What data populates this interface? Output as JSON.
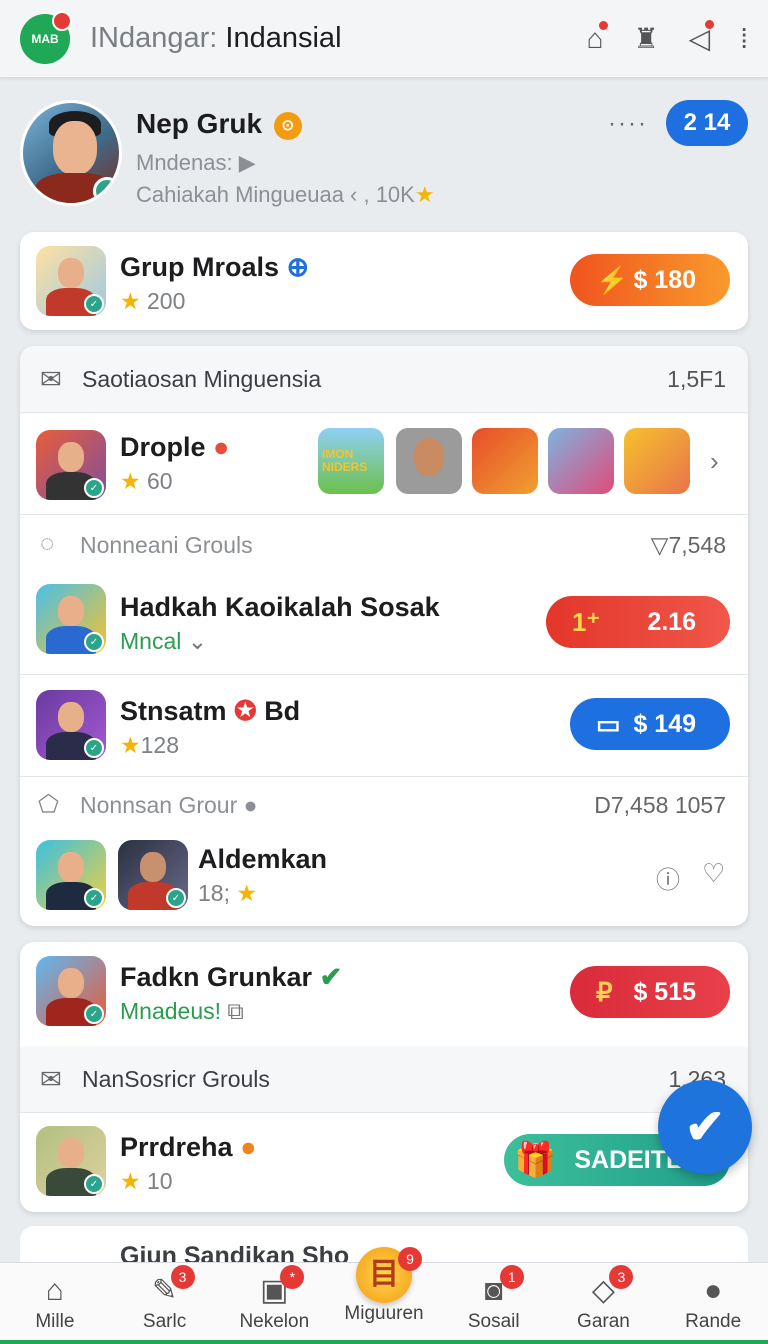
{
  "app": {
    "logo_text": "MAB",
    "title_light": "INdangar:",
    "title_bold": "Indansial",
    "icons": [
      "home-icon",
      "tools-icon",
      "share-icon",
      "more-vertical-icon"
    ]
  },
  "profile": {
    "name": "Nep Gruk",
    "subtitle": "Mndenas:",
    "stats": "Cahiakah Mingueuaa ‹ , 10K",
    "more": "····",
    "badge": "2 14"
  },
  "card1": {
    "title": "Grup Mroals",
    "rating": "200",
    "button": "$ 180"
  },
  "card2": {
    "section": {
      "label": "Saotiaosan Minguensia",
      "value": "1,5F1"
    },
    "drople": {
      "title": "Drople",
      "rating": "60"
    },
    "games": [
      "IMON NIDERS",
      "",
      "",
      "",
      ""
    ],
    "subhead1": {
      "label": "Nonneani Grouls",
      "value": "7,548"
    },
    "hadkah": {
      "title": "Hadkah Kaoikalah Sosak",
      "sub": "Mncal",
      "button": "2.16"
    },
    "stnsatm": {
      "title": "Stnsatm",
      "title_suffix": "Bd",
      "rating": "128",
      "button": "$ 149"
    },
    "subhead2": {
      "label": "Nonnsan Grour",
      "value": "D7,458 1057"
    },
    "aldemkan": {
      "title": "Aldemkan",
      "rating": "18;"
    }
  },
  "card3": {
    "fadkn": {
      "title": "Fadkn Grunkar",
      "sub": "Mnadeus!",
      "button": "$ 515"
    },
    "section": {
      "label": "NanSosricr Grouls",
      "value": "1,263"
    },
    "prrdreha": {
      "title": "Prrdreha",
      "rating": "10",
      "button": "SADEITL"
    }
  },
  "peek": {
    "title": "Giun Sandikan Sho"
  },
  "nav": [
    {
      "label": "Mille",
      "icon": "home-icon",
      "badge": ""
    },
    {
      "label": "Sarlc",
      "icon": "pencil-icon",
      "badge": "3"
    },
    {
      "label": "Nekelon",
      "icon": "image-icon",
      "badge": "*"
    },
    {
      "label": "Miguuren",
      "icon": "coin-icon",
      "badge": "9"
    },
    {
      "label": "Sosail",
      "icon": "camera-icon",
      "badge": "1"
    },
    {
      "label": "Garan",
      "icon": "tag-icon",
      "badge": "3"
    },
    {
      "label": "Rande",
      "icon": "user-icon",
      "badge": ""
    }
  ],
  "colors": {
    "accent_green": "#1fa855",
    "blue": "#1e6fe0",
    "orange": "#f5841f",
    "red": "#e53935"
  }
}
